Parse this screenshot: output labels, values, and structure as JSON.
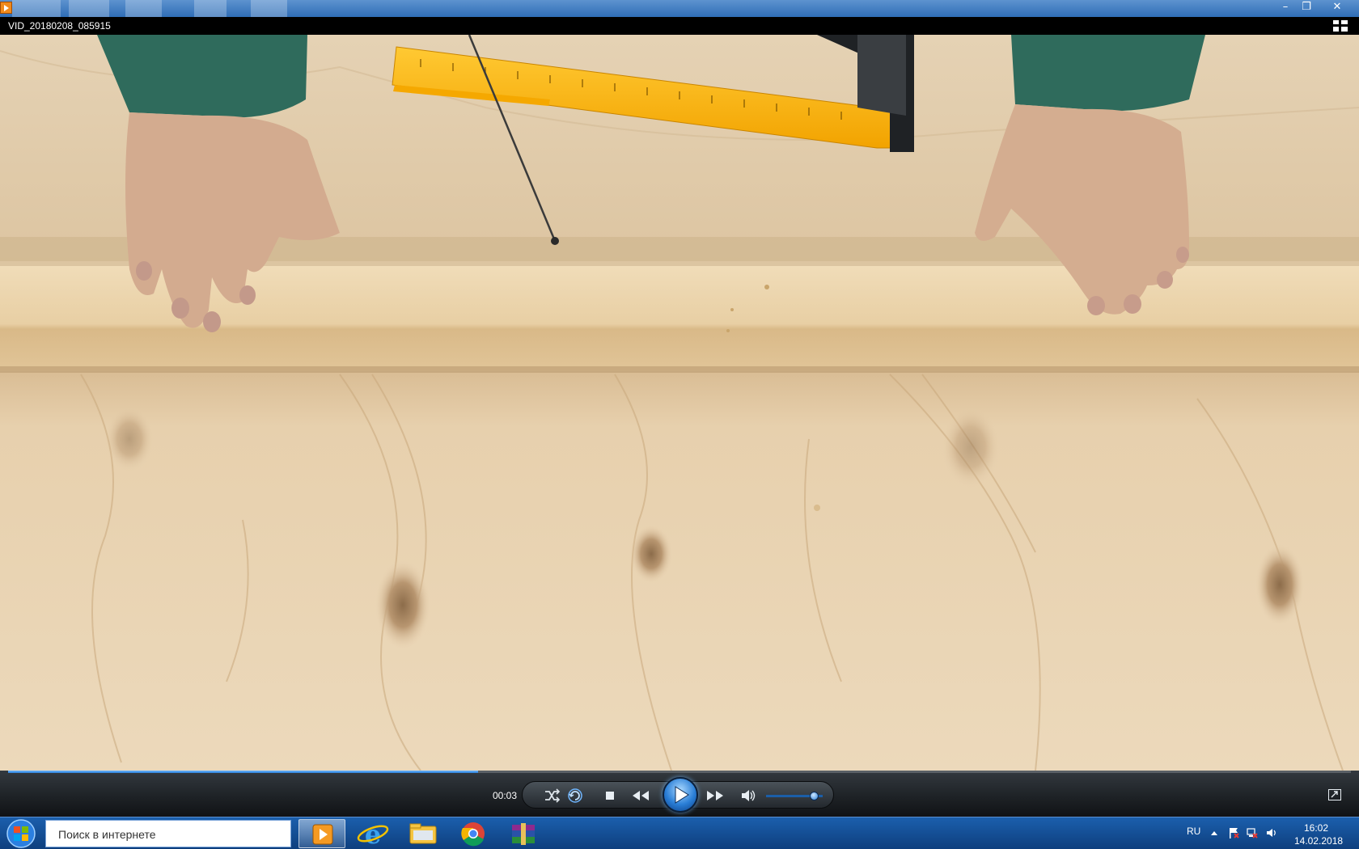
{
  "window": {
    "title": "VID_20180208_085915",
    "minimize_glyph": "–",
    "restore_glyph": "❐",
    "close_glyph": "✕"
  },
  "icons": {
    "app": "media-player-icon",
    "fullscreen": "switch-to-library-icon",
    "shuffle": "shuffle-icon",
    "repeat": "repeat-icon",
    "stop": "stop-icon",
    "previous": "rewind-icon",
    "play": "play-icon",
    "next": "fast-forward-icon",
    "mute": "speaker-icon",
    "switch_view": "switch-view-icon"
  },
  "playback": {
    "time": "00:03",
    "progress": 0.35,
    "volume": 0.85
  },
  "taskbar": {
    "search_placeholder": "Поиск в интернете",
    "apps": [
      {
        "name": "media-player",
        "active": true
      },
      {
        "name": "internet-explorer",
        "active": false
      },
      {
        "name": "file-explorer",
        "active": false
      },
      {
        "name": "chrome",
        "active": false
      },
      {
        "name": "winrar",
        "active": false
      }
    ],
    "language": "RU",
    "clock_time": "16:02",
    "clock_date": "14.02.2018"
  },
  "colors": {
    "accent": "#2a7ed6",
    "taskbar": "#1b5fad"
  }
}
